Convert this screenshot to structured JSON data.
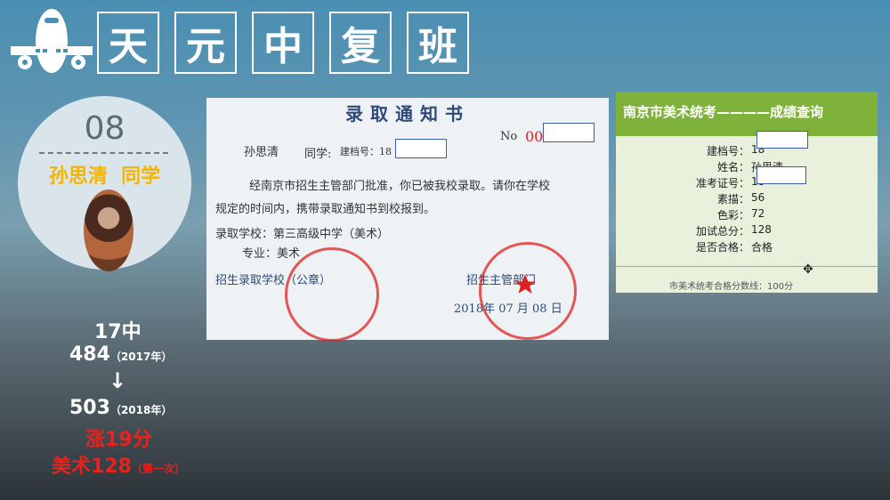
{
  "header": {
    "title_chars": [
      "天",
      "元",
      "中",
      "复",
      "班"
    ]
  },
  "student": {
    "number": "08",
    "name": "孙思清",
    "suffix": "同学"
  },
  "stats": {
    "school": "17中",
    "score_2017": "484",
    "year_2017": "（2017年）",
    "arrow": "↓",
    "score_2018": "503",
    "year_2018": "（2018年）",
    "gain": "涨19分",
    "art": "美术128",
    "art_note": "（第一次）"
  },
  "notice": {
    "title": "录取通知书",
    "no_label": "No",
    "no_prefix": "00",
    "name": "孙思清",
    "classmate": "同学:",
    "file_label": "建档号：18",
    "body1": "经南京市招生主管部门批准，你已被我校录取。请你在学校",
    "body2": "规定的时间内，携带录取通知书到校报到。",
    "school_line": "录取学校：第三高级中学（美术）",
    "major_line": "专业：美术",
    "stamp_school": "招生录取学校（公章）",
    "stamp_dept": "招生主管部门",
    "date": "2018年 07 月 08 日"
  },
  "score_card": {
    "header": "南京市美术统考————成绩查询",
    "rows": [
      {
        "label": "建档号：",
        "value": "18"
      },
      {
        "label": "姓名：",
        "value": "孙思清"
      },
      {
        "label": "准考证号：",
        "value": "18"
      },
      {
        "label": "素描：",
        "value": "56"
      },
      {
        "label": "色彩：",
        "value": "72"
      },
      {
        "label": "加试总分：",
        "value": "128"
      },
      {
        "label": "是否合格：",
        "value": "合格"
      }
    ],
    "footer": "市美术统考合格分数线：100分"
  }
}
